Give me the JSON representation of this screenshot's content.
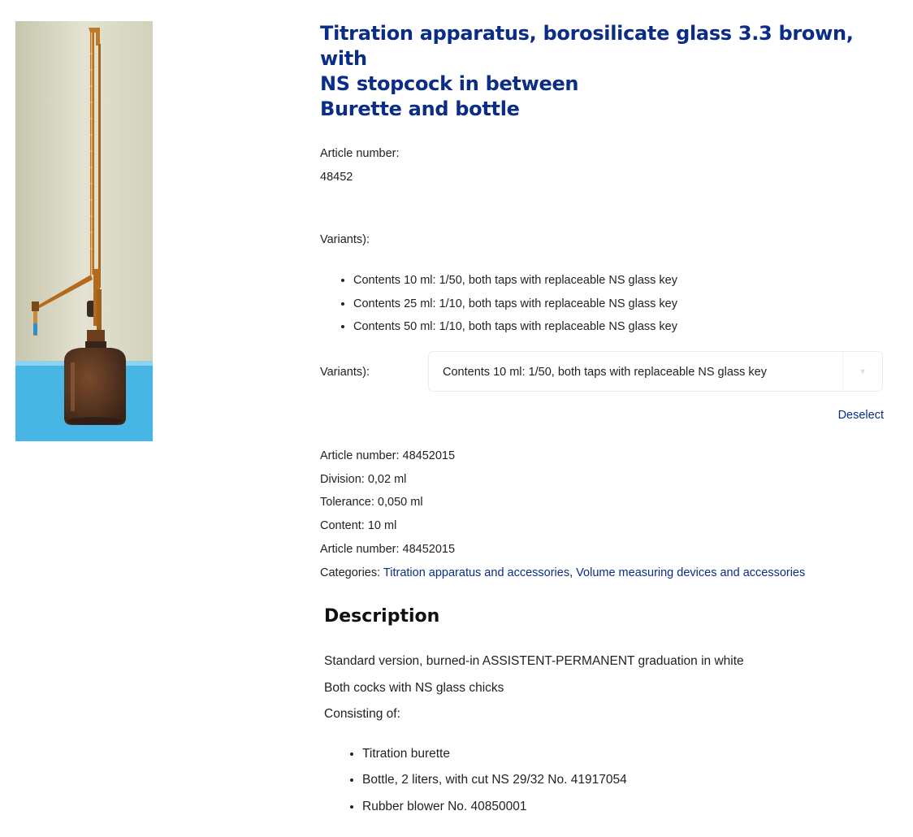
{
  "product": {
    "image_alt": "Titration apparatus brown glass burette with bottle",
    "title_line1": "Titration apparatus, borosilicate glass 3.3 brown, with",
    "title_line2": "NS stopcock in between",
    "title_line3": "Burette and bottle",
    "article_label": "Article number:",
    "article_value": "48452",
    "variants_label": "Variants):",
    "variants": [
      "Contents 10 ml: 1/50, both taps with replaceable NS glass key",
      "Contents 25 ml: 1/10, both taps with replaceable NS glass key",
      "Contents 50 ml: 1/10, both taps with replaceable NS glass key"
    ],
    "selector_label": "Variants):",
    "selected_variant": "Contents 10 ml: 1/50, both taps with replaceable NS glass key",
    "deselect_label": "Deselect",
    "specs": {
      "article_number": "Article number: 48452015",
      "division": "Division: 0,02 ml",
      "tolerance": "Tolerance: 0,050 ml",
      "content": "Content: 10 ml",
      "article_number_2": "Article number: 48452015",
      "categories_label": "Categories: ",
      "category_1": "Titration apparatus and accessories",
      "category_sep": ", ",
      "category_2": "Volume measuring devices and accessories"
    }
  },
  "description": {
    "heading": "Description",
    "line1": "Standard version, burned-in ASSISTENT-PERMANENT graduation in white",
    "line2": "Both cocks with NS glass chicks",
    "line3": "Consisting of:",
    "items": [
      "Titration burette",
      "Bottle, 2 liters, with cut NS 29/32 No. 41917054",
      "Rubber blower No. 40850001"
    ]
  },
  "colors": {
    "title": "#0b2d86",
    "link": "#0b2d86",
    "image_bg_top": "#d9d8c6",
    "image_bg_bottom": "#49b8e6",
    "glass": "#b46a1c"
  },
  "icons": {
    "select_arrow": "chevron-down-icon"
  }
}
